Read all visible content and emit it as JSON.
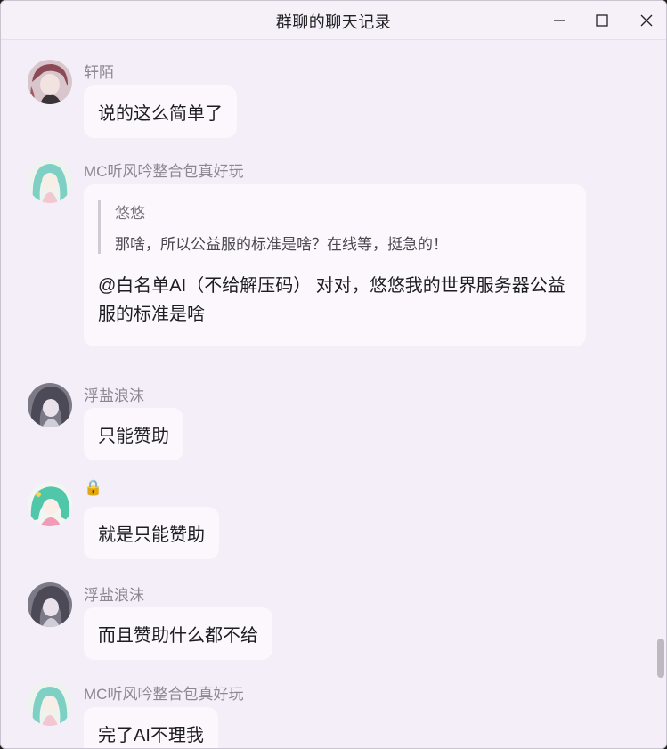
{
  "window": {
    "title": "群聊的聊天记录",
    "controls": {
      "minimize": "minimize-icon",
      "maximize": "maximize-icon",
      "close": "close-icon"
    }
  },
  "messages": [
    {
      "sender": "轩陌",
      "text": "说的这么简单了",
      "avatar": "avatar-pink-hair"
    },
    {
      "sender": "MC听风吟整合包真好玩",
      "avatar": "avatar-teal-hair",
      "quote": {
        "sender": "悠悠",
        "text": "那啥，所以公益服的标准是啥？在线等，挺急的！"
      },
      "text": "@白名单AI（不给解压码） 对对，悠悠我的世界服务器公益服的标准是啥"
    },
    {
      "sender": "浮盐浪沫",
      "text": "只能赞助",
      "avatar": "avatar-gray-hair"
    },
    {
      "sender": "🔒",
      "text": "就是只能赞助",
      "avatar": "avatar-green-hair"
    },
    {
      "sender": "浮盐浪沫",
      "text": "而且赞助什么都不给",
      "avatar": "avatar-gray-hair"
    },
    {
      "sender": "MC听风吟整合包真好玩",
      "text": "完了AI不理我",
      "avatar": "avatar-teal-hair"
    }
  ],
  "colors": {
    "background": "#f3eef7",
    "bubble": "#fbf7fd",
    "name": "#8c8891"
  }
}
